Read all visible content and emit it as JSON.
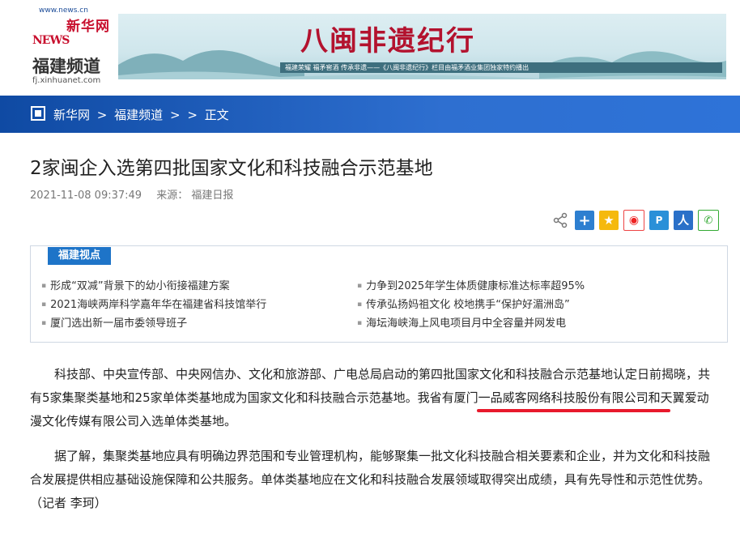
{
  "logo": {
    "url": "www.news.cn",
    "brand": "新华网",
    "news": "NEWS",
    "channel": "福建频道",
    "sub": "fj.xinhuanet.com"
  },
  "banner": {
    "title": "八闽非遗纪行",
    "caption": "福建荣耀 福矛窖酒 传承非遗——《八闽非遗纪行》栏目由福矛酒业集团独家特约播出"
  },
  "breadcrumb": {
    "items": [
      "新华网",
      ">",
      "福建频道",
      ">",
      ">",
      "正文"
    ]
  },
  "article": {
    "title": "2家闽企入选第四批国家文化和科技融合示范基地",
    "date": "2021-11-08 09:37:49",
    "source": "来源： 福建日报"
  },
  "share": {
    "icons": [
      "share-icon",
      "plus-icon",
      "qzone-icon",
      "weibo-icon",
      "tencent-icon",
      "renren-icon",
      "wechat-icon"
    ]
  },
  "viewpoint": {
    "label": "福建视点",
    "left": [
      "形成“双减”背景下的幼小衔接福建方案",
      "2021海峡两岸科学嘉年华在福建省科技馆举行",
      "厦门选出新一届市委领导班子"
    ],
    "right": [
      "力争到2025年学生体质健康标准达标率超95%",
      "传承弘扬妈祖文化 校地携手“保护好湄洲岛”",
      "海坛海峡海上风电项目月中全容量并网发电"
    ]
  },
  "body": {
    "p1_a": "科技部、中央宣传部、中央网信办、文化和旅游部、广电总局启动的第四批国家文化和科技融合示范基地认定日前揭晓，共有5家集聚类基地和25家单体类基地成为国家文化和科技融合示范基地。",
    "p1_b": "我省有厦门一品威客网络科技股份有限公司和天翼爱动漫文化传媒有限公司入选单体类基地。",
    "p2": "据了解，集聚类基地应具有明确边界范围和专业管理机构，能够聚集一批文化科技融合相关要素和企业，并为文化和科技融合发展提供相应基础设施保障和公共服务。单体类基地应在文化和科技融合发展领域取得突出成绩，具有先导性和示范性优势。（记者 李珂）"
  },
  "colors": {
    "nav": "#1b5bbd",
    "tag": "#1e74c8",
    "underline": "#e8192c"
  }
}
